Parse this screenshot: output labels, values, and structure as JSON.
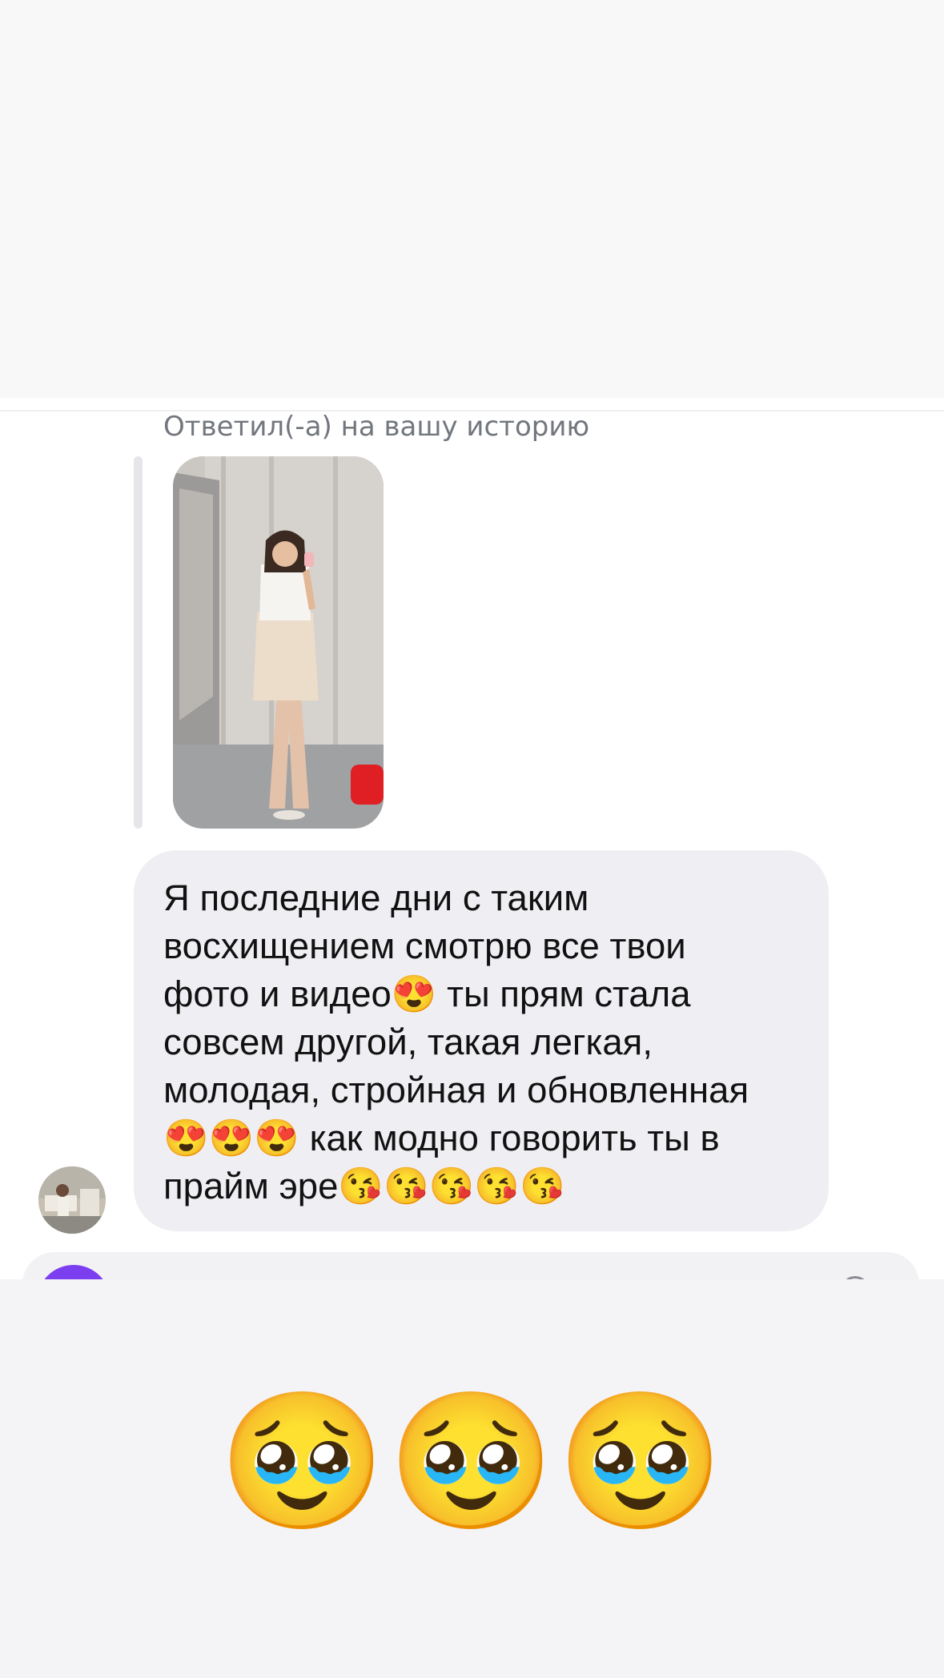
{
  "story_reply": {
    "caption": "Ответил(-а) на вашу историю"
  },
  "message": {
    "text": "Я последние дни с таким\nвосхищением смотрю все твои\nфото и видео😍 ты прям стала\nсовсем другой, такая легкая,\nмолодая, стройная и обновленная\n😍😍😍 как модно говорить ты в\nпрайм эре😘😘😘😘😘"
  },
  "reaction": {
    "emojis": "🥹🥹🥹"
  },
  "colors": {
    "composer_avatar": "#7b3ff0",
    "bubble": "#efeff3",
    "caption": "#72767d"
  }
}
